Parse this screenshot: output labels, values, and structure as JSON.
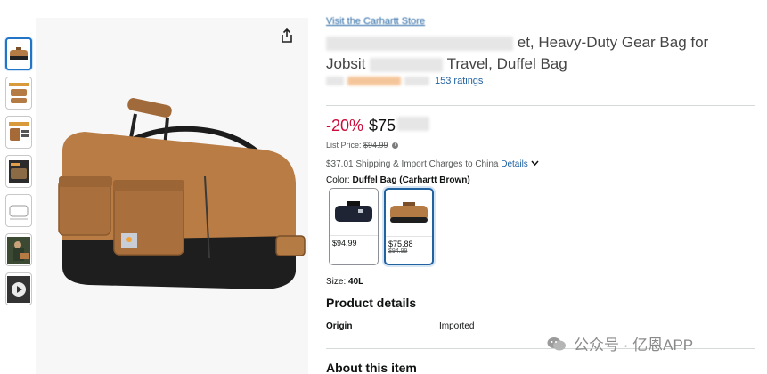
{
  "store_link": "Visit the Carhartt Store",
  "title": {
    "visible_part_line1": "et, Heavy-Duty Gear Bag for",
    "visible_part_line2a": "Jobsit",
    "visible_part_line2b": "Travel, Duffel Bag"
  },
  "rating": {
    "count_label": "153 ratings"
  },
  "price": {
    "discount": "-20%",
    "amount": "$75",
    "list_price_label": "List Price:",
    "list_price_value": "$94.99"
  },
  "shipping": {
    "text": "$37.01 Shipping & Import Charges to China",
    "details_label": "Details"
  },
  "color": {
    "label": "Color:",
    "value": "Duffel Bag (Carhartt Brown)"
  },
  "swatches": [
    {
      "price": "$94.99",
      "old_price": "",
      "color": "#1e2433"
    },
    {
      "price": "$75.88",
      "old_price": "$94.99",
      "color": "#b57b45"
    }
  ],
  "size": {
    "label": "Size:",
    "value": "40L"
  },
  "product_details": {
    "heading": "Product details",
    "rows": [
      {
        "label": "Origin",
        "value": "Imported"
      }
    ]
  },
  "about_heading": "About this item",
  "watermark": "公众号 · 亿恩APP",
  "colors": {
    "link": "#2162a1",
    "discount": "#cc0c39",
    "selected_border": "#2162a1",
    "bag_brown": "#b57b45"
  }
}
